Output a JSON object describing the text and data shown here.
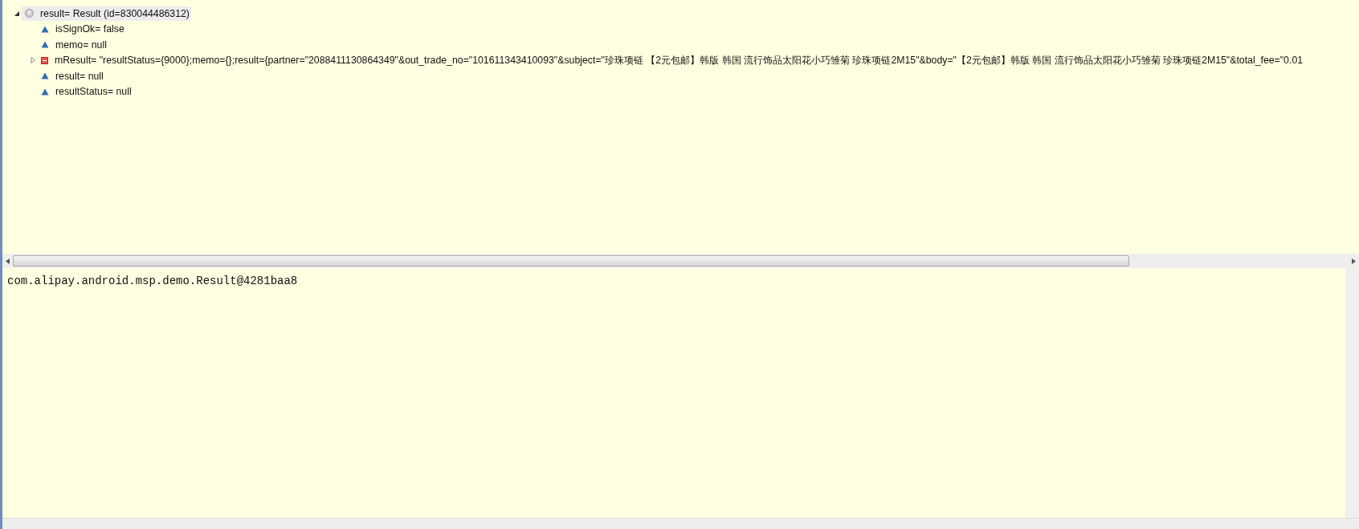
{
  "variables": [
    {
      "label": "result= Result  (id=830044486312)",
      "kind": "object",
      "expanded": true,
      "selected": true,
      "children": [
        {
          "label": "isSignOk= false",
          "kind": "field"
        },
        {
          "label": "memo= null",
          "kind": "field"
        },
        {
          "label": "mResult= \"resultStatus={9000};memo={};result={partner=\"2088411130864349\"&out_trade_no=\"101611343410093\"&subject=\"珍珠项链 【2元包邮】韩版 韩国 流行饰品太阳花小巧雏菊 珍珠项链2M15\"&body=\"【2元包邮】韩版 韩国 流行饰品太阳花小巧雏菊 珍珠项链2M15\"&total_fee=\"0.01",
          "kind": "string",
          "expanded": false
        },
        {
          "label": "result= null",
          "kind": "field"
        },
        {
          "label": "resultStatus= null",
          "kind": "field"
        }
      ]
    }
  ],
  "detail": {
    "text": "com.alipay.android.msp.demo.Result@4281baa8"
  }
}
